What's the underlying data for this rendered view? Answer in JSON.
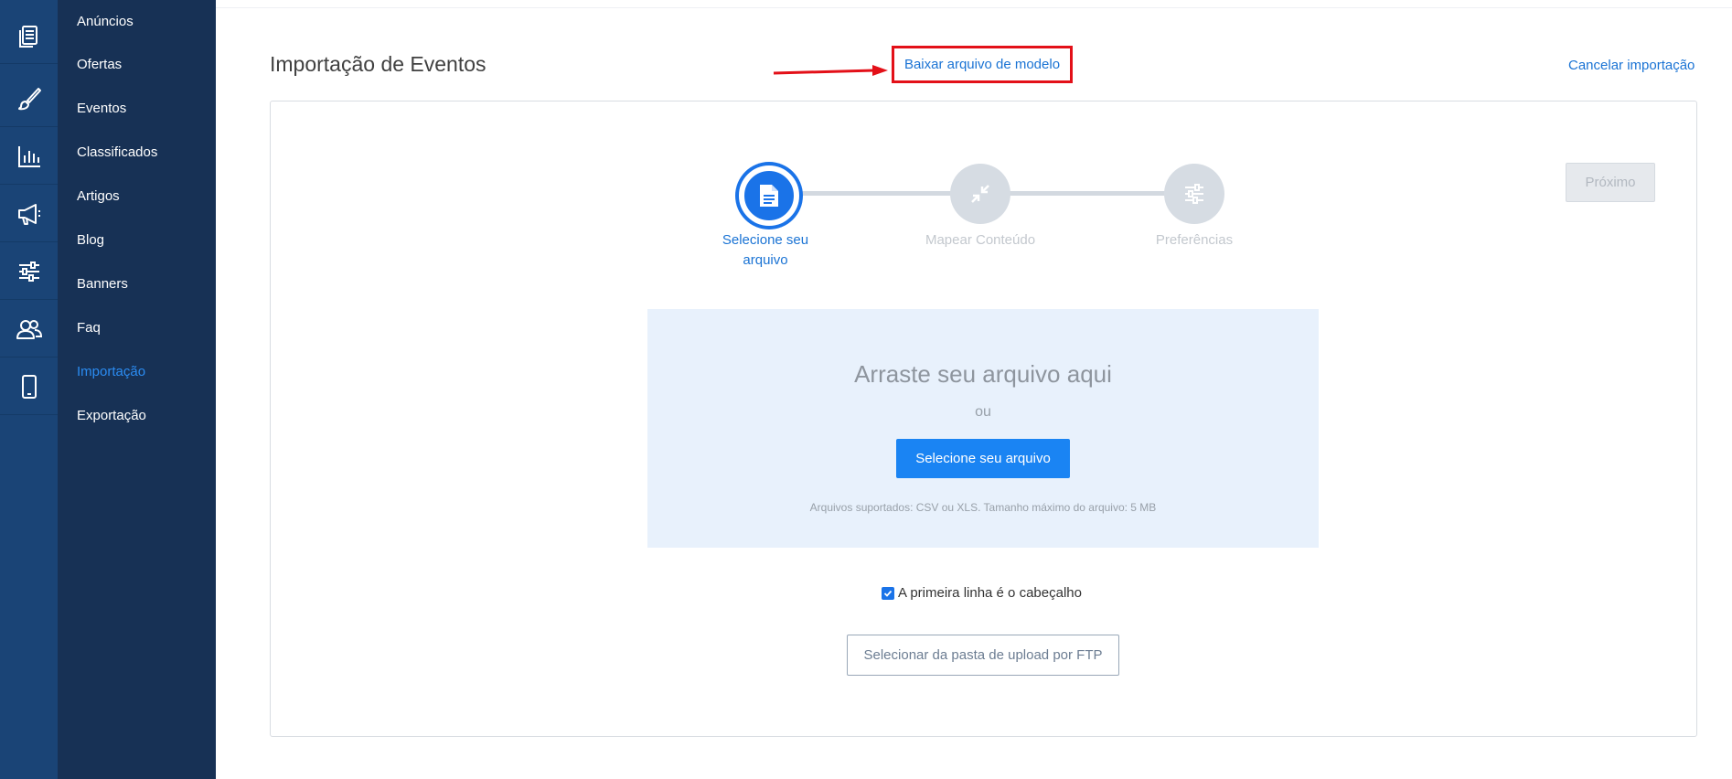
{
  "rail": {
    "icons": [
      "documents-icon",
      "brush-icon",
      "bar-chart-icon",
      "megaphone-icon",
      "sliders-icon",
      "users-icon",
      "mobile-icon"
    ]
  },
  "sidebar": {
    "items": [
      {
        "label": "Anúncios",
        "active": false
      },
      {
        "label": "Ofertas",
        "active": false
      },
      {
        "label": "Eventos",
        "active": false
      },
      {
        "label": "Classificados",
        "active": false
      },
      {
        "label": "Artigos",
        "active": false
      },
      {
        "label": "Blog",
        "active": false
      },
      {
        "label": "Banners",
        "active": false
      },
      {
        "label": "Faq",
        "active": false
      },
      {
        "label": "Importação",
        "active": true
      },
      {
        "label": "Exportação",
        "active": false
      }
    ]
  },
  "header": {
    "title": "Importação de Eventos",
    "download_link": "Baixar arquivo de modelo",
    "cancel_link": "Cancelar importação"
  },
  "wizard": {
    "next_label": "Próximo",
    "steps": [
      {
        "label_line1": "Selecione seu",
        "label_line2": "arquivo",
        "state": "active",
        "icon": "file-icon"
      },
      {
        "label_line1": "Mapear Conteúdo",
        "label_line2": "",
        "state": "todo",
        "icon": "compress-icon"
      },
      {
        "label_line1": "Preferências",
        "label_line2": "",
        "state": "todo",
        "icon": "sliders-icon"
      }
    ]
  },
  "dropzone": {
    "title": "Arraste seu arquivo aqui",
    "or": "ou",
    "button": "Selecione seu arquivo",
    "hint": "Arquivos suportados: CSV ou XLS. Tamanho máximo do arquivo: 5 MB"
  },
  "options": {
    "header_checkbox_label": "A primeira linha é o cabeçalho",
    "header_checkbox_checked": true,
    "ftp_button": "Selecionar da pasta de upload por FTP"
  },
  "colors": {
    "rail_bg": "#1a4476",
    "sidebar_bg": "#173155",
    "accent": "#1a73e8",
    "highlight_red": "#e31018"
  }
}
